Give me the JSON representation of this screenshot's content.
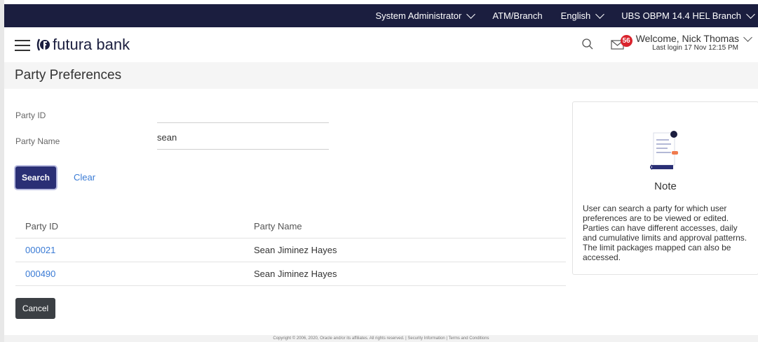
{
  "topbar": {
    "role": "System Administrator",
    "atm_branch": "ATM/Branch",
    "language": "English",
    "branch": "UBS OBPM 14.4 HEL Branch"
  },
  "header": {
    "brand": "futura bank",
    "notifications_count": "56",
    "welcome": "Welcome, Nick Thomas",
    "last_login": "Last login 17 Nov 12:15 PM"
  },
  "page": {
    "title": "Party Preferences"
  },
  "form": {
    "party_id_label": "Party ID",
    "party_id_value": "",
    "party_name_label": "Party Name",
    "party_name_value": "sean",
    "search_label": "Search",
    "clear_label": "Clear"
  },
  "table": {
    "headers": [
      "Party ID",
      "Party Name"
    ],
    "rows": [
      {
        "party_id": "000021",
        "party_name": "Sean Jiminez Hayes"
      },
      {
        "party_id": "000490",
        "party_name": "Sean Jiminez Hayes"
      }
    ]
  },
  "cancel_label": "Cancel",
  "note": {
    "title": "Note",
    "text": "User can search a party for which user preferences are to be viewed or edited. Parties can have different accesses, daily and cumulative limits and approval patterns. The limit packages mapped can also be accessed."
  },
  "footer": "Copyright © 2006, 2020, Oracle and/or its affiliates. All rights reserved. | Security Information | Terms and Conditions",
  "colors": {
    "topbar": "#1b1e3f",
    "primary_button": "#2a2f75",
    "link": "#3a7bd5",
    "badge": "#d9232d"
  }
}
